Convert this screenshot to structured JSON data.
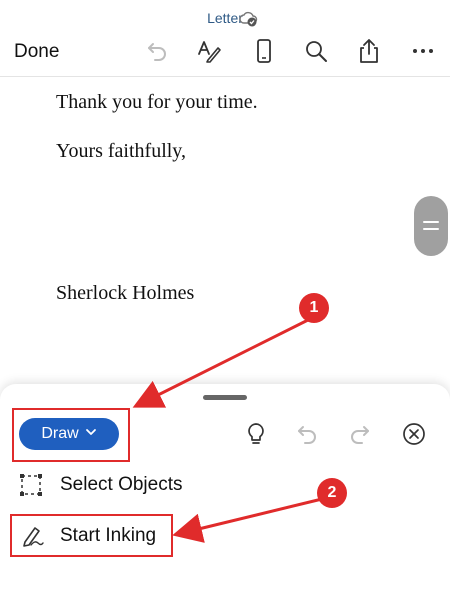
{
  "header": {
    "doc_title": "Letter",
    "done_label": "Done",
    "icons": [
      "undo-icon",
      "text-format-icon",
      "mobile-view-icon",
      "search-icon",
      "share-icon",
      "more-icon"
    ]
  },
  "document": {
    "lines": [
      "Thank you for your time.",
      "Yours faithfully,",
      "Sherlock Holmes"
    ]
  },
  "sheet": {
    "tab_label": "Draw",
    "icons": [
      "lightbulb-icon",
      "undo-icon",
      "redo-icon",
      "close-icon"
    ],
    "items": [
      {
        "label": "Select Objects",
        "icon": "select-objects-icon"
      },
      {
        "label": "Start Inking",
        "icon": "pen-ink-icon"
      }
    ]
  },
  "annotations": {
    "step1": "1",
    "step2": "2",
    "color": "#e02b2b"
  },
  "colors": {
    "accent": "#1f5fbf",
    "title": "#2f5a86"
  }
}
